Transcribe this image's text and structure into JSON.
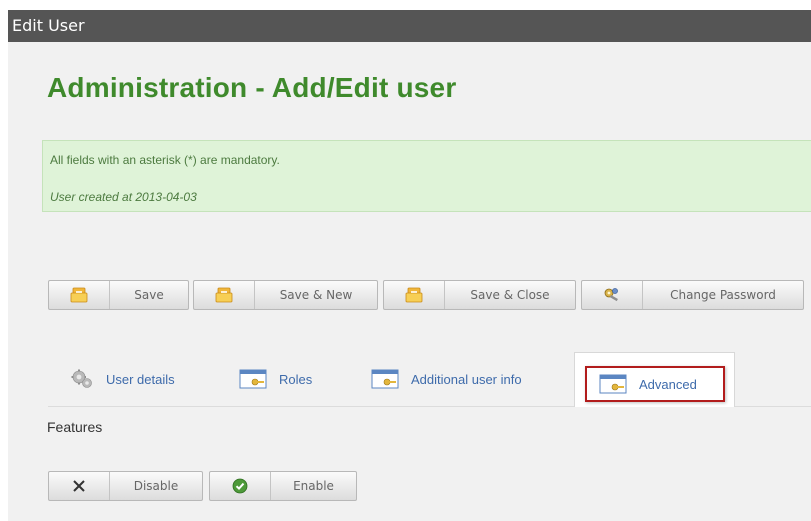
{
  "window": {
    "title": "Edit User"
  },
  "page": {
    "title": "Administration - Add/Edit user"
  },
  "notice": {
    "mandatory": "All fields with an asterisk (*) are mandatory.",
    "created": "User created at 2013-04-03"
  },
  "toolbar": {
    "buttons": [
      {
        "label": "Save",
        "icon": "save-icon"
      },
      {
        "label": "Save & New",
        "icon": "save-new-icon"
      },
      {
        "label": "Save & Close",
        "icon": "save-close-icon"
      },
      {
        "label": "Change Password",
        "icon": "keys-icon"
      }
    ]
  },
  "tabs": [
    {
      "label": "User details",
      "icon": "gear-icon",
      "active": false
    },
    {
      "label": "Roles",
      "icon": "key-card-icon",
      "active": false
    },
    {
      "label": "Additional user info",
      "icon": "key-card-icon",
      "active": false
    },
    {
      "label": "Advanced",
      "icon": "key-card-icon",
      "active": true
    }
  ],
  "features": {
    "label": "Features",
    "buttons": [
      {
        "label": "Disable",
        "icon": "x-icon"
      },
      {
        "label": "Enable",
        "icon": "check-circle-icon"
      }
    ]
  },
  "colors": {
    "title_green": "#3f8a2c",
    "notice_bg": "#dff3d8",
    "tab_text": "#3e6bab",
    "highlight": "#b21c1c",
    "titlebar": "#555555"
  }
}
